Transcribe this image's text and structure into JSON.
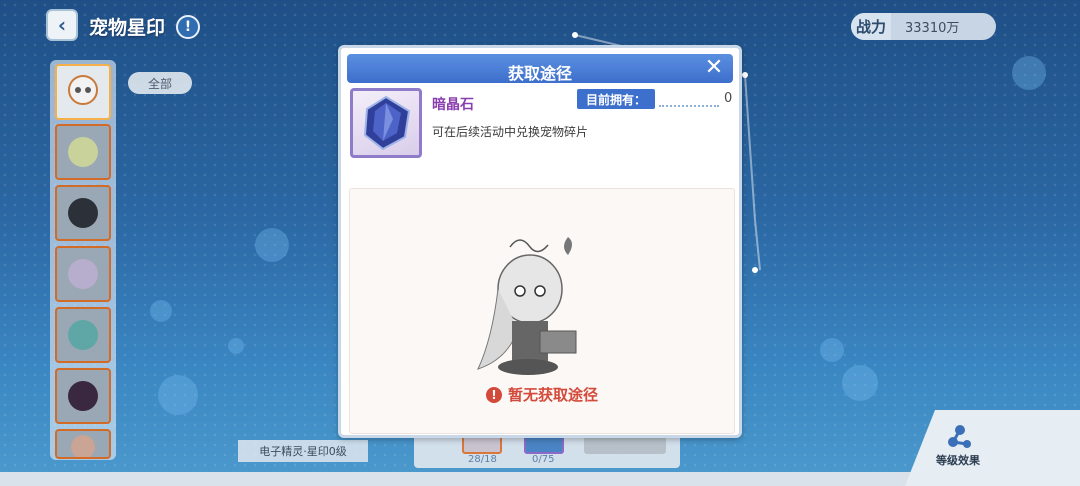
{
  "header": {
    "back_icon": "chevron-left-icon",
    "title": "宠物星印",
    "info_icon": "exclamation-icon"
  },
  "power": {
    "label": "战力",
    "value": "33310万"
  },
  "filter": {
    "label": "全部"
  },
  "sidebar": {
    "pets": [
      {
        "selected": true
      },
      {
        "selected": false
      },
      {
        "selected": false
      },
      {
        "selected": false
      },
      {
        "selected": false
      },
      {
        "selected": false
      },
      {
        "selected": false
      }
    ]
  },
  "bottom": {
    "pet_level_label": "电子精灵·星印0级",
    "material_counts": [
      "28/18",
      "0/75"
    ],
    "level_effect_label": "等级效果"
  },
  "modal": {
    "title": "获取途径",
    "close_icon": "close-icon",
    "item_name": "暗晶石",
    "owned_label": "目前拥有：",
    "owned_value": "0",
    "description": "可在后续活动中兑换宠物碎片",
    "empty_message": "暂无获取途径",
    "colors": {
      "header": "#3d6fcc",
      "item_name": "#8a3fb0",
      "empty_message": "#d44a3a"
    }
  }
}
